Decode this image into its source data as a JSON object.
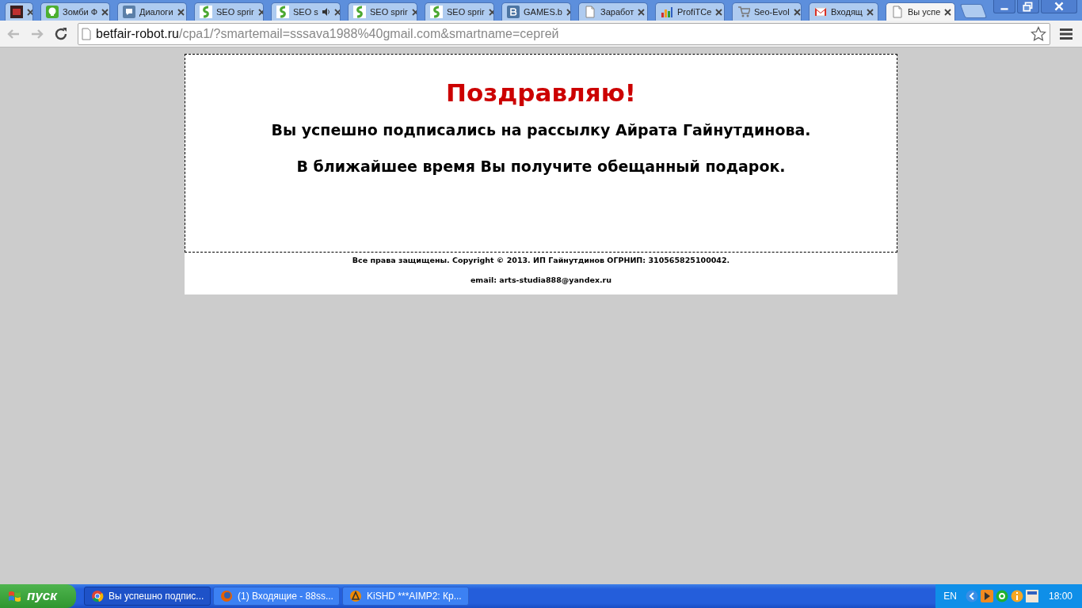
{
  "browser": {
    "tabs": [
      {
        "selected": false
      },
      {
        "label": "Зомби Ф",
        "selected": false
      },
      {
        "label": "Диалоги",
        "selected": false
      },
      {
        "label": "SEO sprir",
        "selected": false
      },
      {
        "label": "SEO s",
        "selected": false,
        "audio": true
      },
      {
        "label": "SEO sprir",
        "selected": false
      },
      {
        "label": "SEO sprir",
        "selected": false
      },
      {
        "label": "GAMES.b",
        "selected": false
      },
      {
        "label": "Заработ",
        "selected": false
      },
      {
        "label": "ProfiTCe",
        "selected": false
      },
      {
        "label": "Seo-Evol",
        "selected": false
      },
      {
        "label": "Входящ",
        "selected": false
      },
      {
        "label": "Вы успе",
        "selected": true
      }
    ],
    "address": {
      "host": "betfair-robot.ru",
      "path": "/cpa1/?smartemail=sssava1988%40gmail.com&smartname=сергей"
    }
  },
  "page": {
    "heading": "Поздравляю!",
    "lines": [
      "Вы успешно подписались на рассылку Айрата Гайнутдинова.",
      "В ближайшее время Вы получите обещанный подарок."
    ],
    "footer": [
      "Все права защищены. Copyright © 2013. ИП Гайнутдинов ОГРНИП: 310565825100042.",
      "email: arts-studia888@yandex.ru"
    ]
  },
  "taskbar": {
    "start": "пуск",
    "tasks": [
      {
        "label": "Вы успешно подпис...",
        "selected": true
      },
      {
        "label": "(1) Входящие - 88ss...",
        "selected": false
      },
      {
        "label": "KiSHD ***AIMP2: Кр...",
        "selected": false
      }
    ],
    "language": "EN",
    "clock": "18:00"
  }
}
